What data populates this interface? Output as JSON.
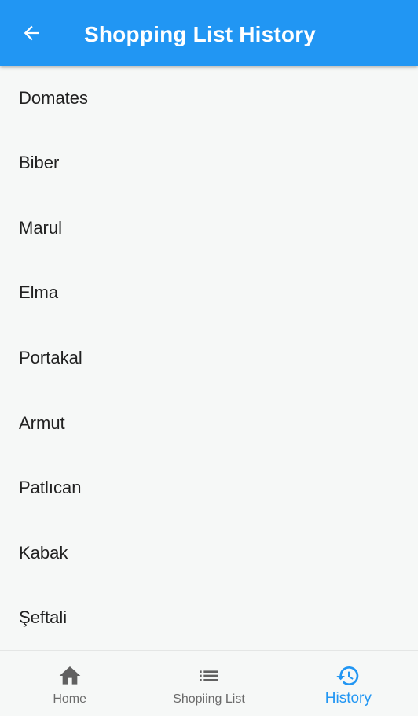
{
  "app_bar": {
    "title": "Shopping List History",
    "back_icon": "arrow-back-icon",
    "background_color": "#2196F3"
  },
  "history": {
    "items": [
      {
        "label": "Domates"
      },
      {
        "label": "Biber"
      },
      {
        "label": "Marul"
      },
      {
        "label": "Elma"
      },
      {
        "label": "Portakal"
      },
      {
        "label": "Armut"
      },
      {
        "label": "Patlıcan"
      },
      {
        "label": "Kabak"
      },
      {
        "label": "Şeftali"
      }
    ]
  },
  "bottom_nav": {
    "items": [
      {
        "label": "Home",
        "icon": "home-icon",
        "active": false
      },
      {
        "label": "Shopiing List",
        "icon": "list-icon",
        "active": false
      },
      {
        "label": "History",
        "icon": "history-icon",
        "active": true
      }
    ],
    "active_color": "#2196F3",
    "inactive_color": "#6B6B6B"
  }
}
